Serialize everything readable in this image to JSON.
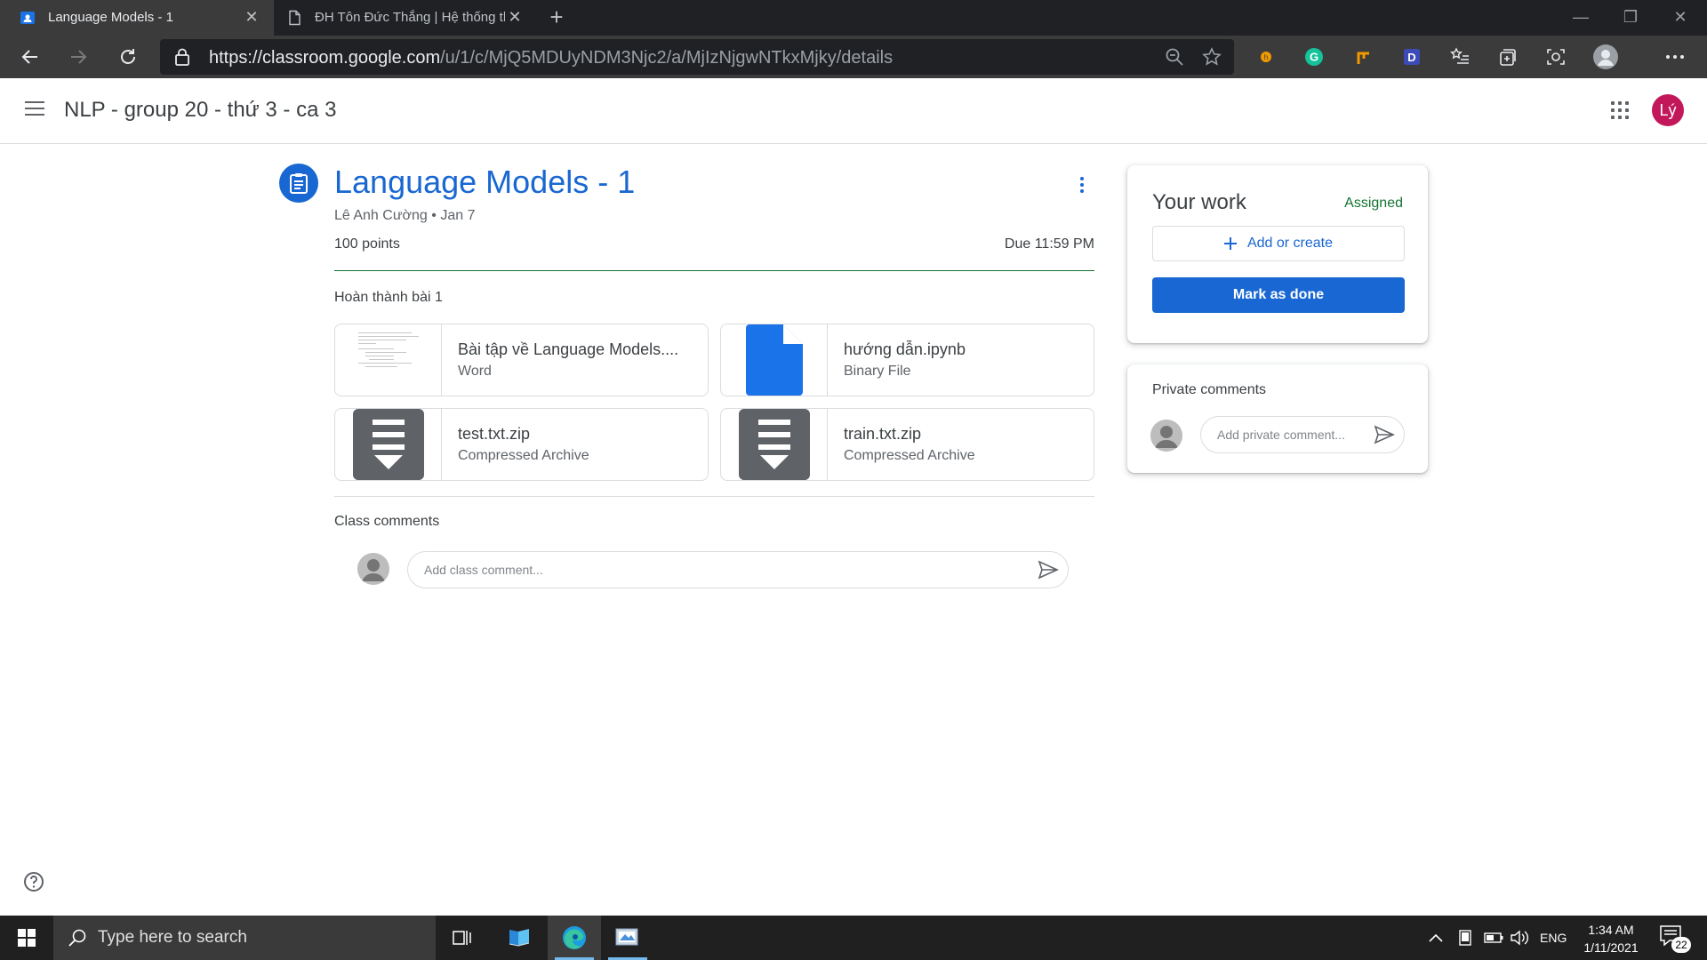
{
  "browser": {
    "tabs": [
      {
        "title": "Language Models - 1",
        "active": true
      },
      {
        "title": "ĐH Tôn Đức Thắng | Hệ thống thông tin sinh viên",
        "active": false
      }
    ],
    "url_host": "https://classroom.google.com",
    "url_path": "/u/1/c/MjQ5MDUyNDM3Njc2/a/MjIzNjgwNTkxMjky/details",
    "extensions": [
      "honey-icon",
      "grammarly-icon",
      "pen-icon",
      "dashlane-icon"
    ]
  },
  "appbar": {
    "class_name": "NLP - group 20 - thứ 3 - ca 3",
    "avatar_initials": "Lý",
    "avatar_color": "#c2185b"
  },
  "assignment": {
    "title": "Language Models - 1",
    "author": "Lê Anh Cường",
    "separator": "•",
    "date": "Jan 7",
    "points": "100 points",
    "due": "Due 11:59 PM",
    "instructions": "Hoàn thành bài 1",
    "attachments": [
      {
        "name": "Bài tập về Language Models....",
        "type": "Word",
        "thumb": "doc-preview"
      },
      {
        "name": "hướng dẫn.ipynb",
        "type": "Binary File",
        "thumb": "file-icon"
      },
      {
        "name": "test.txt.zip",
        "type": "Compressed Archive",
        "thumb": "archive-icon"
      },
      {
        "name": "train.txt.zip",
        "type": "Compressed Archive",
        "thumb": "archive-icon"
      }
    ],
    "class_comments_label": "Class comments",
    "class_comment_placeholder": "Add class comment..."
  },
  "your_work": {
    "title": "Your work",
    "status": "Assigned",
    "add_label": "Add or create",
    "done_label": "Mark as done"
  },
  "private_comments": {
    "title": "Private comments",
    "placeholder": "Add private comment..."
  },
  "taskbar": {
    "search_placeholder": "Type here to search",
    "language": "ENG",
    "time": "1:34 AM",
    "date": "1/11/2021",
    "notification_count": "22"
  },
  "colors": {
    "accent": "#1967d2",
    "assigned": "#137333",
    "chrome_dark": "#202124"
  }
}
